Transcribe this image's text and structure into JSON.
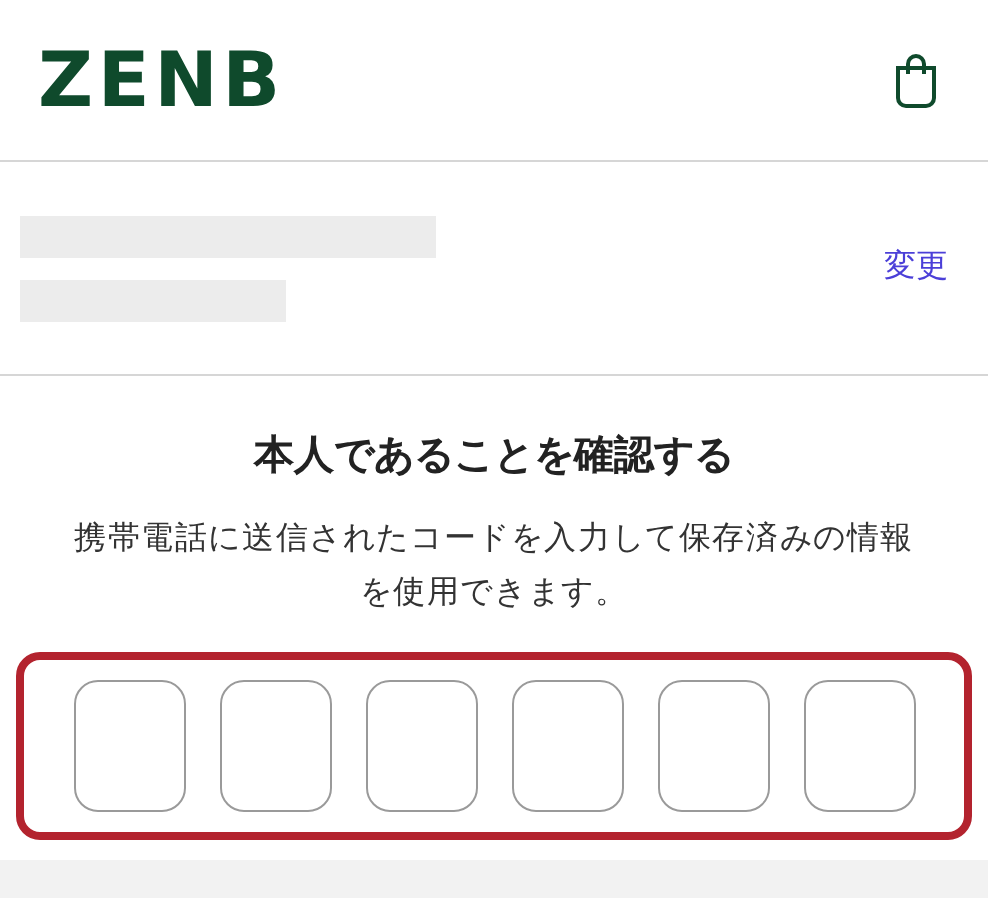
{
  "header": {
    "logo": "ZENB"
  },
  "account": {
    "change_link": "変更"
  },
  "verify": {
    "title": "本人であることを確認する",
    "description": "携帯電話に送信されたコードを入力して保存済みの情報を使用できます。",
    "code_group": {
      "highlighted": true,
      "fields": [
        {
          "kind": "digit"
        },
        {
          "kind": "digit"
        },
        {
          "kind": "digit"
        },
        {
          "kind": "digit"
        },
        {
          "kind": "digit"
        },
        {
          "kind": "digit"
        }
      ]
    }
  }
}
